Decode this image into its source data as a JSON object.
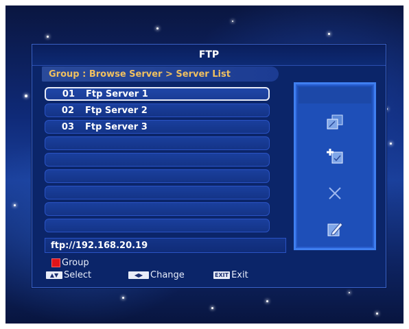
{
  "window": {
    "title": "FTP"
  },
  "breadcrumb": {
    "text": "Group : Browse Server > Server List"
  },
  "servers": [
    {
      "num": "01",
      "name": "Ftp Server 1"
    },
    {
      "num": "02",
      "name": "Ftp Server 2"
    },
    {
      "num": "03",
      "name": "Ftp Server 3"
    }
  ],
  "address": {
    "url": "ftp://192.168.20.19"
  },
  "side_actions": [
    {
      "icon": "copy-icon"
    },
    {
      "icon": "add-icon"
    },
    {
      "icon": "delete-icon"
    },
    {
      "icon": "edit-icon"
    }
  ],
  "help": {
    "group": "Group",
    "select": "Select",
    "change": "Change",
    "exit_key": "EXIT",
    "exit": "Exit"
  },
  "colors": {
    "panel_blue": "#0b2569",
    "highlight_border": "#e8ecf8",
    "breadcrumb_text": "#f0c060",
    "red_key": "#e0141a"
  }
}
